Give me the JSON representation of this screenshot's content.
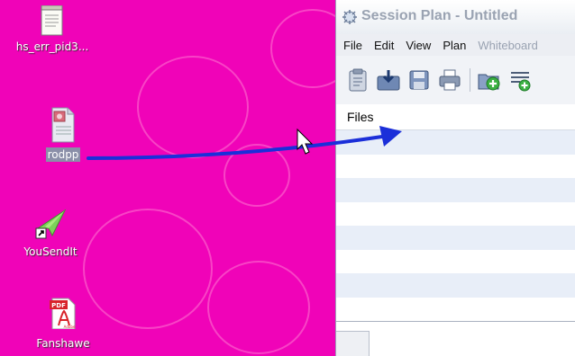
{
  "desktop": {
    "background": "#f003b8",
    "icons": [
      {
        "label": "hs_err_pid3...",
        "icon": "text-file-icon"
      },
      {
        "label": "rodpp",
        "icon": "document-file-icon",
        "selected": true
      },
      {
        "label": "YouSendIt",
        "icon": "yousendit-shortcut-icon"
      },
      {
        "label": "Fanshawe",
        "icon": "pdf-file-icon",
        "badge": "PDF",
        "brand": "Adobe"
      }
    ]
  },
  "window": {
    "title": "Session Plan - Untitled",
    "menu": [
      "File",
      "Edit",
      "View",
      "Plan",
      "Whiteboard"
    ],
    "toolbar": [
      "clipboard-icon",
      "import-icon",
      "save-icon",
      "print-icon",
      "new-folder-icon",
      "add-list-icon"
    ],
    "files_header": "Files"
  },
  "drag_arrow_color": "#1b2fd9"
}
